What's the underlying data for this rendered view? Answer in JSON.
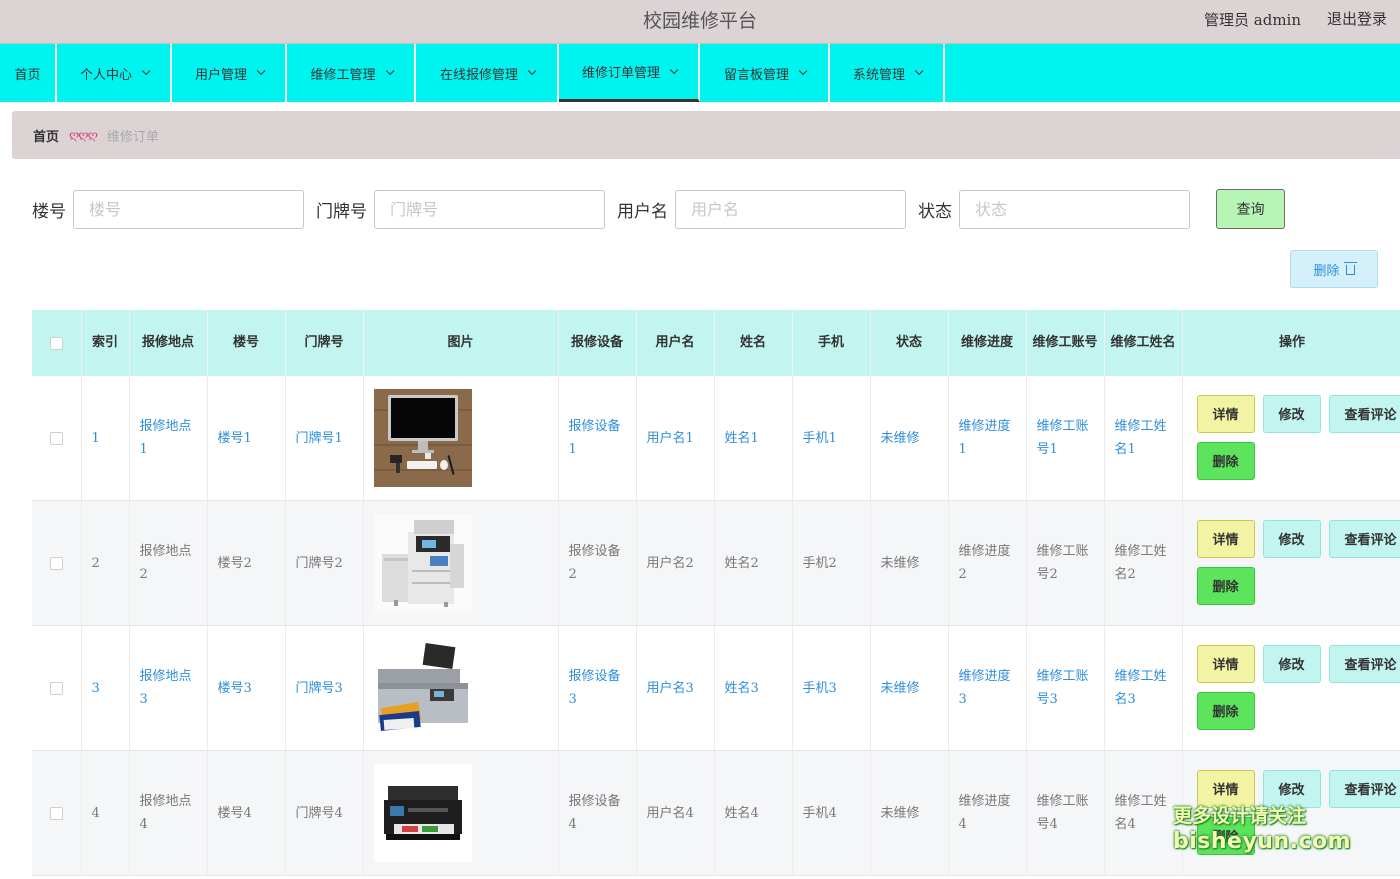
{
  "header": {
    "title": "校园维修平台",
    "admin_label": "管理员 admin",
    "logout_label": "退出登录"
  },
  "nav": {
    "items": [
      {
        "label": "首页"
      },
      {
        "label": "个人中心"
      },
      {
        "label": "用户管理"
      },
      {
        "label": "维修工管理"
      },
      {
        "label": "在线报修管理"
      },
      {
        "label": "维修订单管理"
      },
      {
        "label": "留言板管理"
      },
      {
        "label": "系统管理"
      }
    ],
    "active": "维修订单管理"
  },
  "breadcrumb": {
    "home": "首页",
    "separator": "ღღღ",
    "current": "维修订单"
  },
  "search": {
    "fields": [
      {
        "label": "楼号",
        "placeholder": "楼号",
        "value": ""
      },
      {
        "label": "门牌号",
        "placeholder": "门牌号",
        "value": ""
      },
      {
        "label": "用户名",
        "placeholder": "用户名",
        "value": ""
      },
      {
        "label": "状态",
        "placeholder": "状态",
        "value": ""
      }
    ],
    "query_label": "查询"
  },
  "actions": {
    "delete_label": "删除"
  },
  "table": {
    "headers": [
      "索引",
      "报修地点",
      "楼号",
      "门牌号",
      "图片",
      "报修设备",
      "用户名",
      "姓名",
      "手机",
      "状态",
      "维修进度",
      "维修工账号",
      "维修工姓名",
      "操作"
    ],
    "rows": [
      {
        "index": "1",
        "location": "报修地点1",
        "building": "楼号1",
        "door": "门牌号1",
        "image": "monitor-desk-image",
        "device": "报修设备1",
        "username": "用户名1",
        "name": "姓名1",
        "phone": "手机1",
        "status": "未维修",
        "progress": "维修进度1",
        "worker_account": "维修工账号1",
        "worker_name": "维修工姓名1"
      },
      {
        "index": "2",
        "location": "报修地点2",
        "building": "楼号2",
        "door": "门牌号2",
        "image": "copier-image",
        "device": "报修设备2",
        "username": "用户名2",
        "name": "姓名2",
        "phone": "手机2",
        "status": "未维修",
        "progress": "维修进度2",
        "worker_account": "维修工账号2",
        "worker_name": "维修工姓名2"
      },
      {
        "index": "3",
        "location": "报修地点3",
        "building": "楼号3",
        "door": "门牌号3",
        "image": "scanner-printer-image",
        "device": "报修设备3",
        "username": "用户名3",
        "name": "姓名3",
        "phone": "手机3",
        "status": "未维修",
        "progress": "维修进度3",
        "worker_account": "维修工账号3",
        "worker_name": "维修工姓名3"
      },
      {
        "index": "4",
        "location": "报修地点4",
        "building": "楼号4",
        "door": "门牌号4",
        "image": "printer-image",
        "device": "报修设备4",
        "username": "用户名4",
        "name": "姓名4",
        "phone": "手机4",
        "status": "未维修",
        "progress": "维修进度4",
        "worker_account": "维修工账号4",
        "worker_name": "维修工姓名4"
      }
    ],
    "row_buttons": {
      "detail": "详情",
      "edit": "修改",
      "review": "查看评论",
      "delete": "删除"
    }
  },
  "watermark": {
    "line1": "更多设计请关注",
    "line2": "bisheyun.com"
  },
  "colors": {
    "nav_bg": "#00f4ef",
    "header_bg": "#dcd4d4",
    "link": "#2f8fdc",
    "table_header_bg": "#c3f5f0"
  }
}
